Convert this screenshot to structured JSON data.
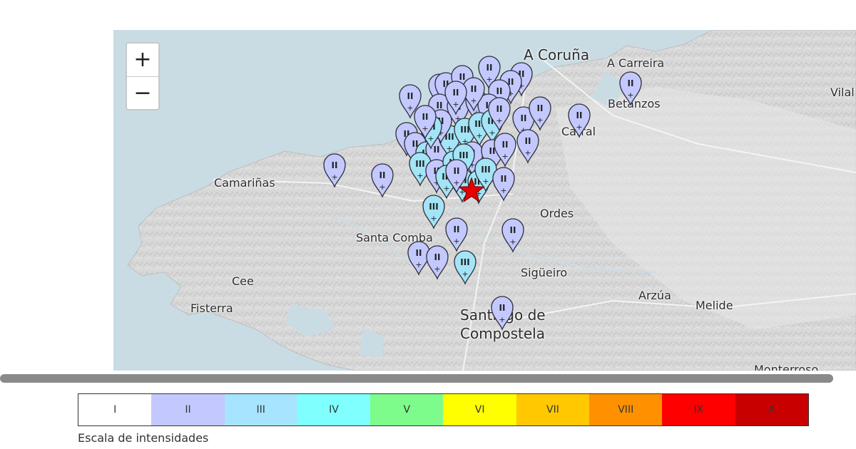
{
  "map": {
    "places": [
      {
        "name": "A Coruña"
      },
      {
        "name": "A Carreira"
      },
      {
        "name": "Vilal"
      },
      {
        "name": "Betanzos"
      },
      {
        "name": "Carral"
      },
      {
        "name": "Camariñas"
      },
      {
        "name": "Ordes"
      },
      {
        "name": "Santa Comba"
      },
      {
        "name": "Sigüeiro"
      },
      {
        "name": "Cee"
      },
      {
        "name": "Fisterra"
      },
      {
        "name": "Arzúa"
      },
      {
        "name": "Melide"
      },
      {
        "name": "Santiago de"
      },
      {
        "name": "Compostela"
      },
      {
        "name": "Monterroso"
      }
    ],
    "epicenter": {
      "icon": "star-icon",
      "color": "#e60000"
    }
  },
  "zoom": {
    "in_label": "+",
    "out_label": "−"
  },
  "intensity_colors": {
    "II": "#c3c9ff",
    "III": "#a3e4f7"
  },
  "legend": {
    "caption": "Escala de intensidades",
    "levels": [
      {
        "label": "I",
        "color": "#ffffff"
      },
      {
        "label": "II",
        "color": "#c3c9ff"
      },
      {
        "label": "III",
        "color": "#a6e4ff"
      },
      {
        "label": "IV",
        "color": "#80ffff"
      },
      {
        "label": "V",
        "color": "#7dfb8b"
      },
      {
        "label": "VI",
        "color": "#ffff00"
      },
      {
        "label": "VII",
        "color": "#ffc800"
      },
      {
        "label": "VIII",
        "color": "#ff9100"
      },
      {
        "label": "IX",
        "color": "#ff0000"
      },
      {
        "label": "X",
        "color": "#c80000"
      }
    ]
  }
}
